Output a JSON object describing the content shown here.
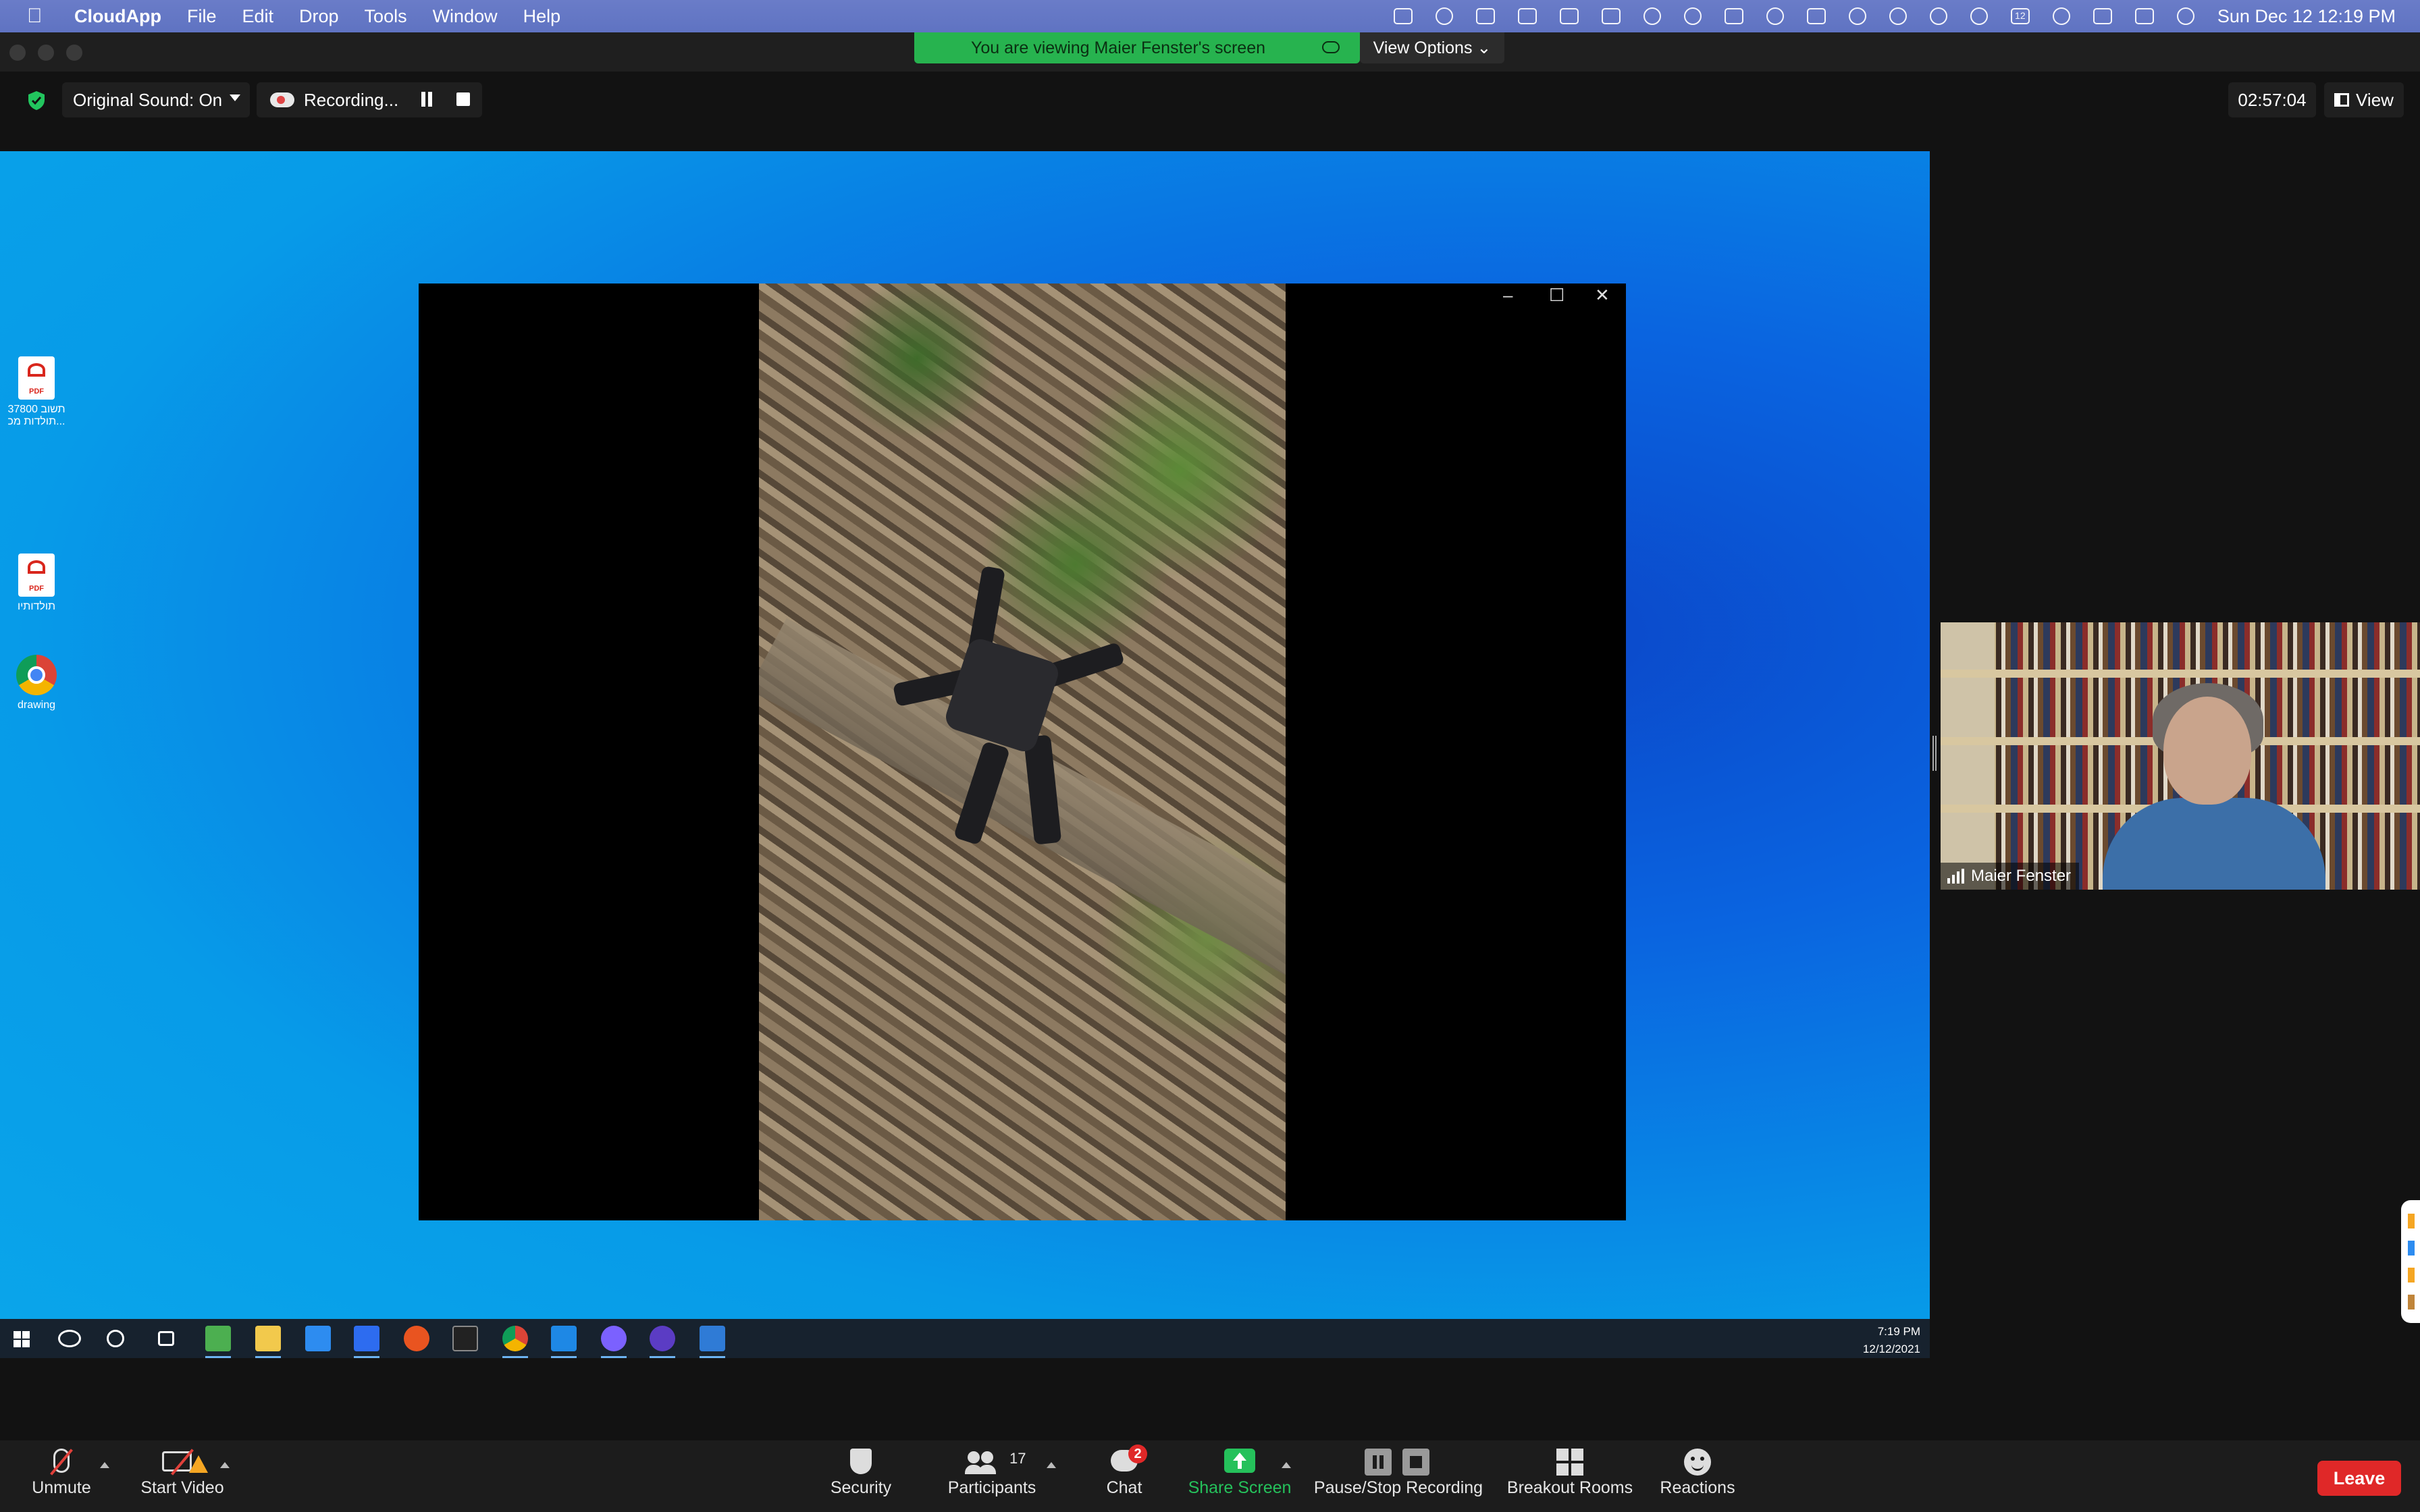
{
  "menubar": {
    "app_name": "CloudApp",
    "menus": [
      "File",
      "Edit",
      "Drop",
      "Tools",
      "Window",
      "Help"
    ],
    "calendar_day": "12",
    "clock": "Sun Dec 12  12:19 PM"
  },
  "banner": {
    "text": "You are viewing Maier Fenster's screen",
    "view_options": "View Options ⌄"
  },
  "toolbar": {
    "original_sound": "Original Sound: On",
    "recording": "Recording...",
    "timer": "02:57:04",
    "view": "View"
  },
  "shared_screen": {
    "desktop_icons": [
      {
        "label": "37800 תשוב\nתולדות מכ...",
        "type": "pdf-icon"
      },
      {
        "label": "תולדותיו",
        "type": "pdf-icon"
      },
      {
        "label": "drawing",
        "type": "chrome-icon"
      }
    ],
    "player_controls": [
      "–",
      "☐",
      "✕"
    ],
    "taskbar_time": "7:19 PM",
    "taskbar_date": "12/12/2021"
  },
  "participant": {
    "name": "Maier Fenster"
  },
  "bottombar": {
    "unmute": "Unmute",
    "start_video": "Start Video",
    "security": "Security",
    "participants": "Participants",
    "participants_count": "17",
    "chat": "Chat",
    "chat_badge": "2",
    "share_screen": "Share Screen",
    "pause_stop_recording": "Pause/Stop Recording",
    "breakout_rooms": "Breakout Rooms",
    "reactions": "Reactions",
    "leave": "Leave"
  },
  "colors": {
    "share_green": "#25c15b",
    "leave_red": "#e02828",
    "banner_green": "#27b34f"
  }
}
